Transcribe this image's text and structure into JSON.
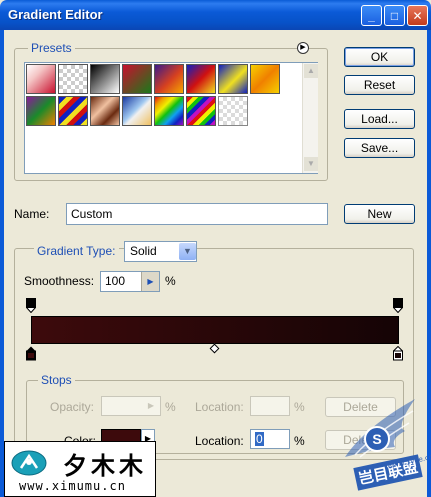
{
  "window": {
    "title": "Gradient Editor"
  },
  "title_controls": {
    "minimize": "_",
    "maximize": "□",
    "close": "✕"
  },
  "presets": {
    "legend": "Presets",
    "menu_glyph": "▶"
  },
  "buttons": {
    "ok": "OK",
    "reset": "Reset",
    "load": "Load...",
    "save": "Save...",
    "new": "New"
  },
  "name_field": {
    "label": "Name:",
    "value": "Custom"
  },
  "gradient_type": {
    "label": "Gradient Type:",
    "value": "Solid"
  },
  "smoothness": {
    "label": "Smoothness:",
    "value": "100",
    "unit": "%"
  },
  "stops": {
    "legend": "Stops",
    "opacity_label": "Opacity:",
    "opacity_unit": "%",
    "location_label": "Location:",
    "location_unit": "%",
    "delete_label": "Delete",
    "color_label": "Color:",
    "color_location_label": "Location:",
    "color_location_value": "0",
    "color_location_unit": "%",
    "color_delete_label": "Delete"
  },
  "gradient": {
    "start_color": "#3d0a0c",
    "end_color": "#150405"
  },
  "watermark": {
    "chars": "夕木木",
    "url": "www.ximumu.cn",
    "brand": "岂目联盟",
    "site": "www.5yee.com"
  }
}
